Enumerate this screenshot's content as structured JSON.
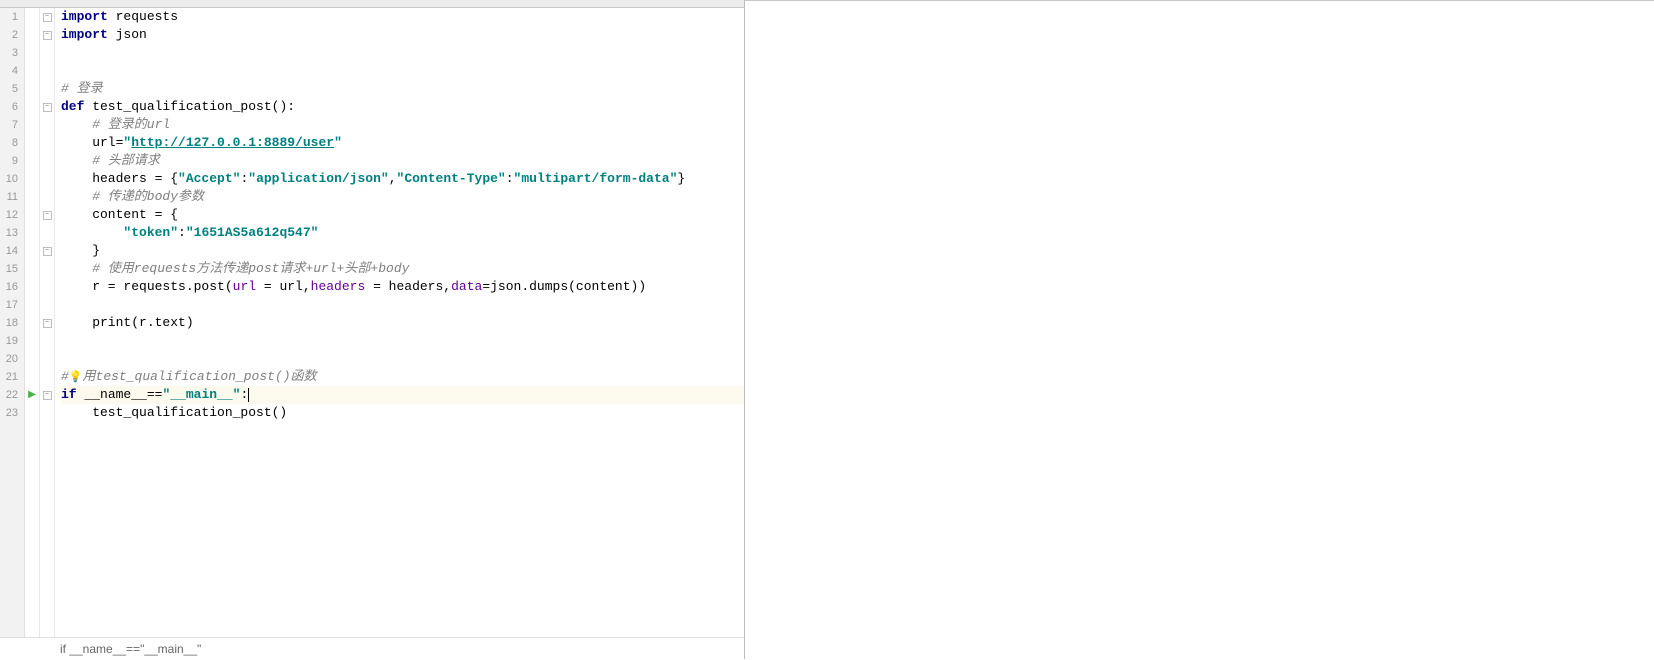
{
  "gutter": [
    "1",
    "2",
    "3",
    "4",
    "5",
    "6",
    "7",
    "8",
    "9",
    "10",
    "11",
    "12",
    "13",
    "14",
    "15",
    "16",
    "17",
    "18",
    "19",
    "20",
    "21",
    "22",
    "23"
  ],
  "code": {
    "l1": {
      "kw": "import",
      "mod": " requests"
    },
    "l2": {
      "kw": "import",
      "mod": " json"
    },
    "l5": "# 登录",
    "l6": {
      "kw": "def",
      "name": " test_qualification_post():"
    },
    "l7": "    # 登录的url",
    "l8": {
      "pre": "    url=",
      "q1": "\"",
      "url": "http://127.0.0.1:8889/user",
      "q2": "\""
    },
    "l9": "    # 头部请求",
    "l10": {
      "pre": "    headers = {",
      "s1": "\"Accept\"",
      "c1": ":",
      "s2": "\"application/json\"",
      "c2": ",",
      "s3": "\"Content-Type\"",
      "c3": ":",
      "s4": "\"multipart/form-data\"",
      "end": "}"
    },
    "l11": "    # 传递的body参数",
    "l12": "    content = {",
    "l13": {
      "pre": "        ",
      "s1": "\"token\"",
      "c1": ":",
      "s2": "\"1651AS5a612q547\""
    },
    "l14": "    }",
    "l15": "    # 使用requests方法传递post请求+url+头部+body",
    "l16": {
      "pre": "    r = requests.post(",
      "p1": "url",
      "e1": " = url,",
      "p2": "headers",
      "e2": " = headers,",
      "p3": "data",
      "e3": "=json.dumps(content))"
    },
    "l18": "    print(r.text)",
    "l21": "#调用test_qualification_post()函数",
    "l22": {
      "kw": "if",
      "rest": " __name__==",
      "s": "\"__main__\"",
      "colon": ":"
    },
    "l23": "    test_qualification_post()"
  },
  "breadcrumb": "if __name__==\"__main__\"",
  "fold_marks": [
    1,
    2,
    6,
    12,
    14,
    18,
    22
  ],
  "run_marks": [
    22
  ],
  "highlight_line": 22,
  "bulb_line": 21
}
